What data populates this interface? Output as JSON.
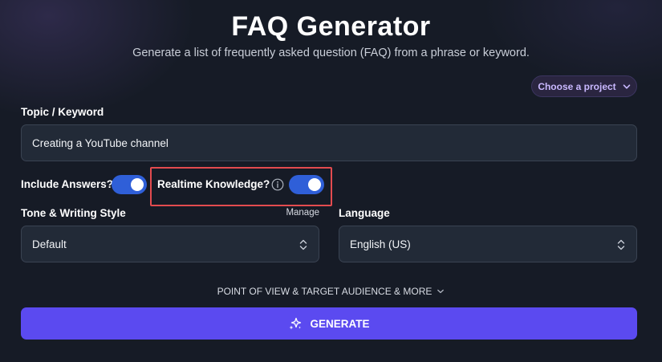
{
  "header": {
    "title": "FAQ Generator",
    "subtitle": "Generate a list of frequently asked question (FAQ) from a phrase or keyword."
  },
  "project_selector": {
    "label": "Choose a project"
  },
  "topic": {
    "label": "Topic / Keyword",
    "value": "Creating a YouTube channel"
  },
  "options": {
    "include_answers": {
      "label": "Include Answers?",
      "enabled": true
    },
    "realtime_knowledge": {
      "label": "Realtime Knowledge?",
      "enabled": true
    }
  },
  "tone": {
    "label": "Tone & Writing Style",
    "manage_label": "Manage",
    "value": "Default"
  },
  "language": {
    "label": "Language",
    "value": "English (US)"
  },
  "more_options": {
    "label": "POINT OF VIEW & TARGET AUDIENCE & MORE"
  },
  "generate": {
    "label": "GENERATE"
  },
  "colors": {
    "background": "#161b26",
    "accent": "#5b4af0",
    "toggle_on": "#2f5fd8",
    "highlight": "#e34b4f",
    "project_text": "#c9b8ff"
  },
  "icons": [
    "chevron-down-icon",
    "info-icon",
    "updown-chevron-icon",
    "sparkles-icon"
  ]
}
